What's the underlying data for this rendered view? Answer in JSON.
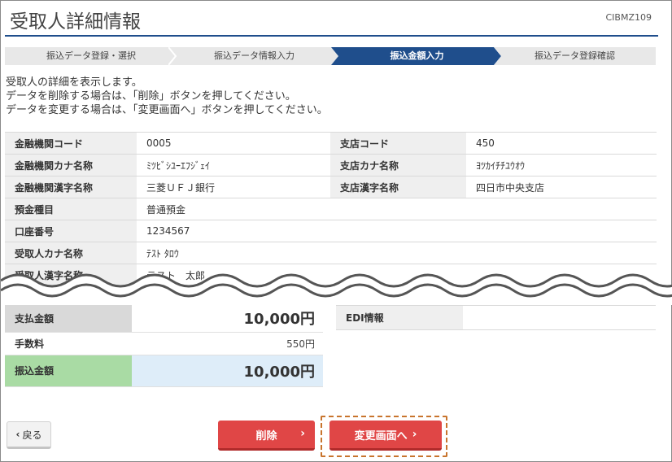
{
  "header": {
    "title": "受取人詳細情報",
    "screen_id": "CIBMZ109"
  },
  "steps": [
    {
      "label": "振込データ登録・選択",
      "active": false
    },
    {
      "label": "振込データ情報入力",
      "active": false
    },
    {
      "label": "振込金額入力",
      "active": true
    },
    {
      "label": "振込データ登録確認",
      "active": false
    }
  ],
  "instructions": [
    "受取人の詳細を表示します。",
    "データを削除する場合は、「削除」ボタンを押してください。",
    "データを変更する場合は、「変更画面へ」ボタンを押してください。"
  ],
  "details": {
    "bank_code": {
      "label": "金融機関コード",
      "value": "0005"
    },
    "branch_code": {
      "label": "支店コード",
      "value": "450"
    },
    "bank_kana": {
      "label": "金融機関カナ名称",
      "value": "ﾐﾂﾋﾞｼﾕｰｴﾌｼﾞｪｲ"
    },
    "branch_kana": {
      "label": "支店カナ名称",
      "value": "ﾖﾂｶｲﾁﾁﾕｳｵｳ"
    },
    "bank_kanji": {
      "label": "金融機関漢字名称",
      "value": "三菱ＵＦＪ銀行"
    },
    "branch_kanji": {
      "label": "支店漢字名称",
      "value": "四日市中央支店"
    },
    "deposit_type": {
      "label": "預金種目",
      "value": "普通預金"
    },
    "account_no": {
      "label": "口座番号",
      "value": "1234567"
    },
    "payee_kana": {
      "label": "受取人カナ名称",
      "value": "ﾃｽﾄ ﾀﾛｳ"
    },
    "payee_kanji": {
      "label": "受取人漢字名称",
      "value": "テスト　太郎"
    }
  },
  "amounts": {
    "payment": {
      "label": "支払金額",
      "value": "10,000円"
    },
    "fee": {
      "label": "手数料",
      "value": "550円"
    },
    "transfer": {
      "label": "振込金額",
      "value": "10,000円"
    }
  },
  "edi": {
    "label": "EDI情報",
    "value": ""
  },
  "buttons": {
    "back": "戻る",
    "delete": "削除",
    "change": "変更画面へ"
  },
  "colors": {
    "accent": "#1f4e8c",
    "button_red": "#e04646",
    "transfer_label_bg": "#a9dba4",
    "transfer_value_bg": "#deedf9",
    "highlight": "#c8742d"
  }
}
